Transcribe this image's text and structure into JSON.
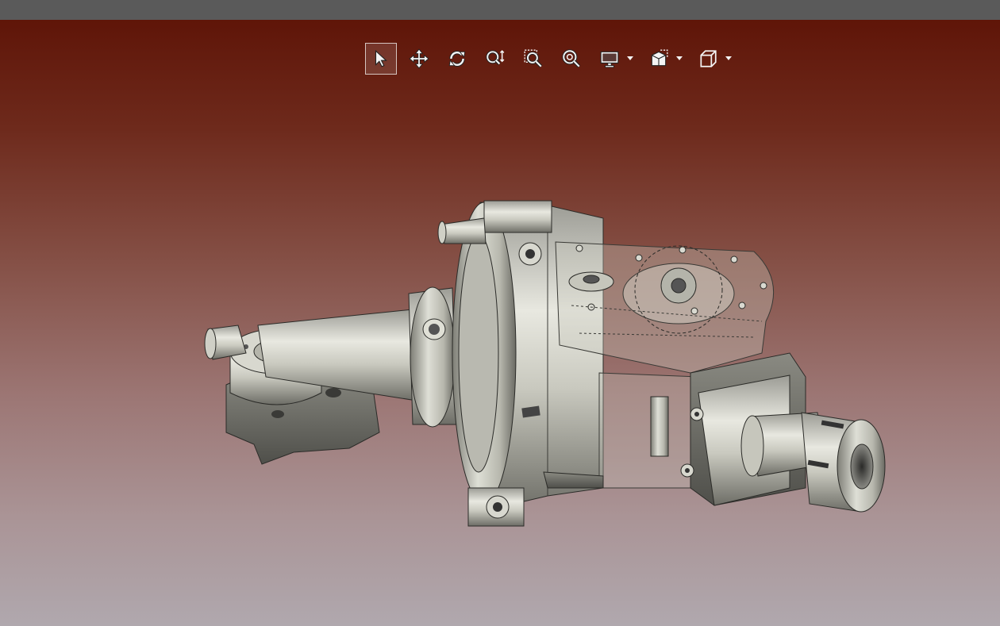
{
  "window": {
    "titlebar_color": "#5a5a5a"
  },
  "viewport": {
    "background_top": "#5f1508",
    "background_bottom": "#b0a8ae",
    "model_description_icon": "mechanical-assembly-3d-model"
  },
  "toolbar": {
    "items": [
      {
        "name": "select",
        "icon": "cursor-arrow-icon",
        "active": true
      },
      {
        "name": "pan",
        "icon": "move-arrows-icon",
        "active": false
      },
      {
        "name": "rotate",
        "icon": "rotate-icon",
        "active": false
      },
      {
        "name": "zoom",
        "icon": "zoom-vertical-icon",
        "active": false
      },
      {
        "name": "zoom-window",
        "icon": "zoom-box-icon",
        "active": false
      },
      {
        "name": "zoom-fit",
        "icon": "zoom-fit-icon",
        "active": false
      },
      {
        "name": "display-mode",
        "icon": "monitor-icon",
        "dropdown": true
      },
      {
        "name": "section-view",
        "icon": "section-plane-icon",
        "dropdown": true
      },
      {
        "name": "view-orientation",
        "icon": "cube-view-icon",
        "dropdown": true
      }
    ]
  }
}
